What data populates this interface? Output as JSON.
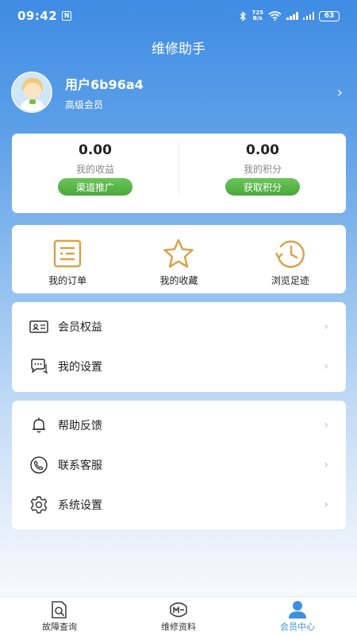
{
  "status_bar": {
    "time": "09:42",
    "net_speed_value": "725",
    "net_speed_unit": "B/s",
    "battery": "63"
  },
  "app_title": "维修助手",
  "profile": {
    "username": "用户6b96a4",
    "level": "高级会员"
  },
  "stats": [
    {
      "value": "0.00",
      "label": "我的收益",
      "button": "渠道推广"
    },
    {
      "value": "0.00",
      "label": "我的积分",
      "button": "获取积分"
    }
  ],
  "quick_actions": [
    {
      "label": "我的订单",
      "icon": "order-list-icon"
    },
    {
      "label": "我的收藏",
      "icon": "star-icon"
    },
    {
      "label": "浏览足迹",
      "icon": "history-clock-icon"
    }
  ],
  "menu_group_1": [
    {
      "label": "会员权益",
      "icon": "id-card-icon"
    },
    {
      "label": "我的设置",
      "icon": "chat-bubbles-icon"
    }
  ],
  "menu_group_2": [
    {
      "label": "帮助反馈",
      "icon": "bell-icon"
    },
    {
      "label": "联系客服",
      "icon": "phone-icon"
    },
    {
      "label": "系统设置",
      "icon": "gear-icon"
    }
  ],
  "bottom_nav": [
    {
      "label": "故障查询",
      "icon": "document-search-icon",
      "active": false
    },
    {
      "label": "维修资料",
      "icon": "wrench-badge-icon",
      "active": false
    },
    {
      "label": "会员中心",
      "icon": "user-icon",
      "active": true
    }
  ],
  "colors": {
    "accent": "#3d8fe3",
    "green_button": "#4aa83b",
    "gold_icon": "#d9a24a"
  }
}
